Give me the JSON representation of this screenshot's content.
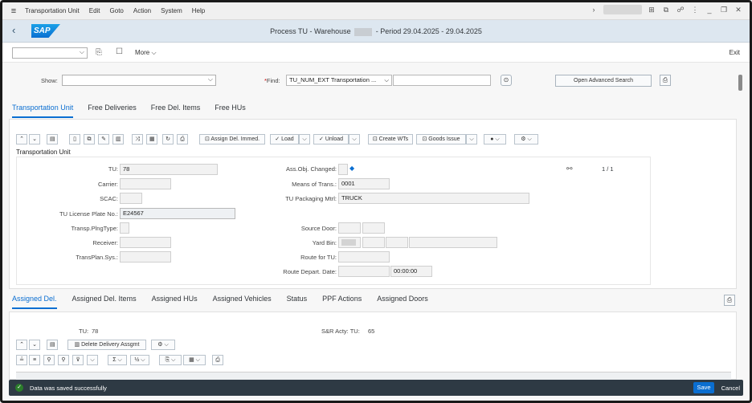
{
  "menubar": {
    "items": [
      "Transportation Unit",
      "Edit",
      "Goto",
      "Action",
      "System",
      "Help"
    ]
  },
  "shell": {
    "logo": "SAP",
    "title_prefix": "Process TU - Warehouse",
    "title_suffix": "- Period 29.04.2025 - 29.04.2025"
  },
  "toolbar": {
    "more_label": "More",
    "exit_label": "Exit"
  },
  "search": {
    "show_label": "Show:",
    "find_label": "Find:",
    "find_required": "*",
    "find_value": "TU_NUM_EXT Transportation ...",
    "advanced_label": "Open Advanced Search"
  },
  "main_tabs": [
    "Transportation Unit",
    "Free Deliveries",
    "Free Del. Items",
    "Free HUs"
  ],
  "panel": {
    "title": "Transportation Unit",
    "buttons": {
      "assign": "Assign Del. Immed.",
      "load": "Load",
      "unload": "Unload",
      "create_wts": "Create WTs",
      "goods_issue": "Goods Issue"
    },
    "page_indicator": "1  /  1",
    "fields": {
      "tu_label": "TU:",
      "tu_value": "78",
      "carrier_label": "Carrier:",
      "scac_label": "SCAC:",
      "plate_label": "TU License Plate No.:",
      "plate_value": "E24567",
      "plng_label": "Transp.PlngType:",
      "receiver_label": "Receiver:",
      "transplan_label": "TransPlan.Sys.:",
      "assobj_label": "Ass.Obj. Changed:",
      "means_label": "Means of Trans.:",
      "means_value": "0001",
      "packaging_label": "TU Packaging Mtrl:",
      "packaging_value": "TRUCK",
      "source_label": "Source Door:",
      "yard_label": "Yard Bin:",
      "route_label": "Route for TU:",
      "depart_label": "Route Depart. Date:",
      "depart_time": "00:00:00"
    }
  },
  "bottom_tabs": [
    "Assigned Del.",
    "Assigned Del. Items",
    "Assigned HUs",
    "Assigned Vehicles",
    "Status",
    "PPF Actions",
    "Assigned Doors"
  ],
  "bottom": {
    "tu_label": "TU:",
    "tu_value": "78",
    "sr_label": "S&R Acty: TU:",
    "sr_value": "65",
    "delete_label": "Delete Delivery Assgmt"
  },
  "message": {
    "text": "Data was saved successfully",
    "save_label": "Save",
    "cancel_label": "Cancel"
  }
}
